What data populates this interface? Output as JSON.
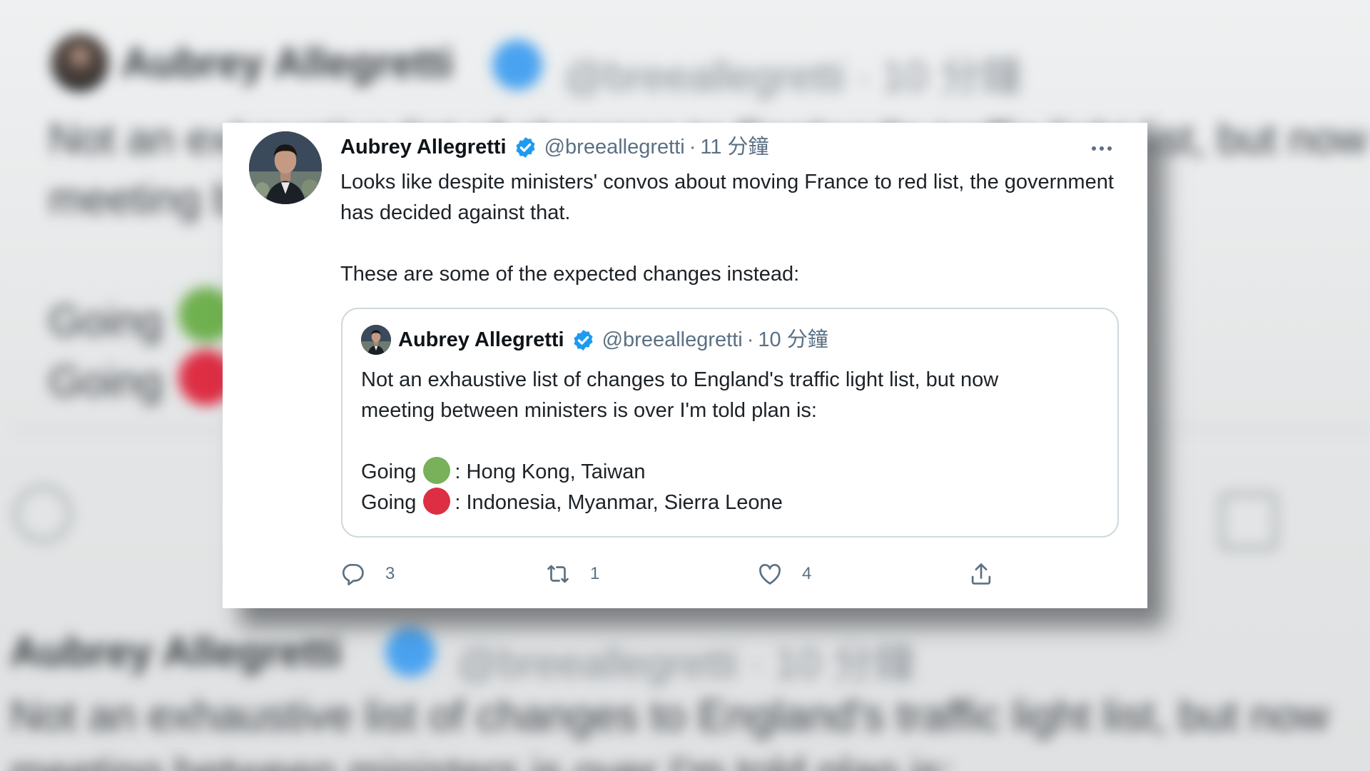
{
  "background": {
    "name": "Aubrey Allegretti",
    "handle": "@breeallegretti · 10 分鐘",
    "line1": "Not an exhaustive list of changes to England's traffic light list, but now",
    "line2": "meeting between ministers is over I'm told plan is:",
    "going1": "Going",
    "going2": "Going"
  },
  "tweet": {
    "author_name": "Aubrey Allegretti",
    "handle": "@breeallegretti",
    "separator": "·",
    "time": "11 分鐘",
    "text_p1": "Looks like despite ministers' convos about moving France to red list, the government has decided against that.",
    "text_p2": "These are some of the expected changes instead:"
  },
  "quoted_tweet": {
    "author_name": "Aubrey Allegretti",
    "handle": "@breeallegretti",
    "separator": "·",
    "time": "10 分鐘",
    "line1": "Not an exhaustive list of changes to England's traffic light list, but now",
    "line2": "meeting between ministers is over I'm told plan is:",
    "green_prefix": "Going",
    "green_countries": ": Hong Kong, Taiwan",
    "red_prefix": "Going",
    "red_countries": ": Indonesia, Myanmar, Sierra Leone"
  },
  "actions": {
    "replies": "3",
    "retweets": "1",
    "likes": "4"
  },
  "icons": {
    "verified": "verified-badge-icon",
    "more": "more-horizontal-icon",
    "reply": "reply-icon",
    "retweet": "retweet-icon",
    "like": "heart-icon",
    "share": "share-icon"
  },
  "colors": {
    "verified_blue": "#1d9bf0",
    "green_light": "#78b159",
    "red_light": "#dd2e44",
    "secondary_text": "#5b7083"
  }
}
